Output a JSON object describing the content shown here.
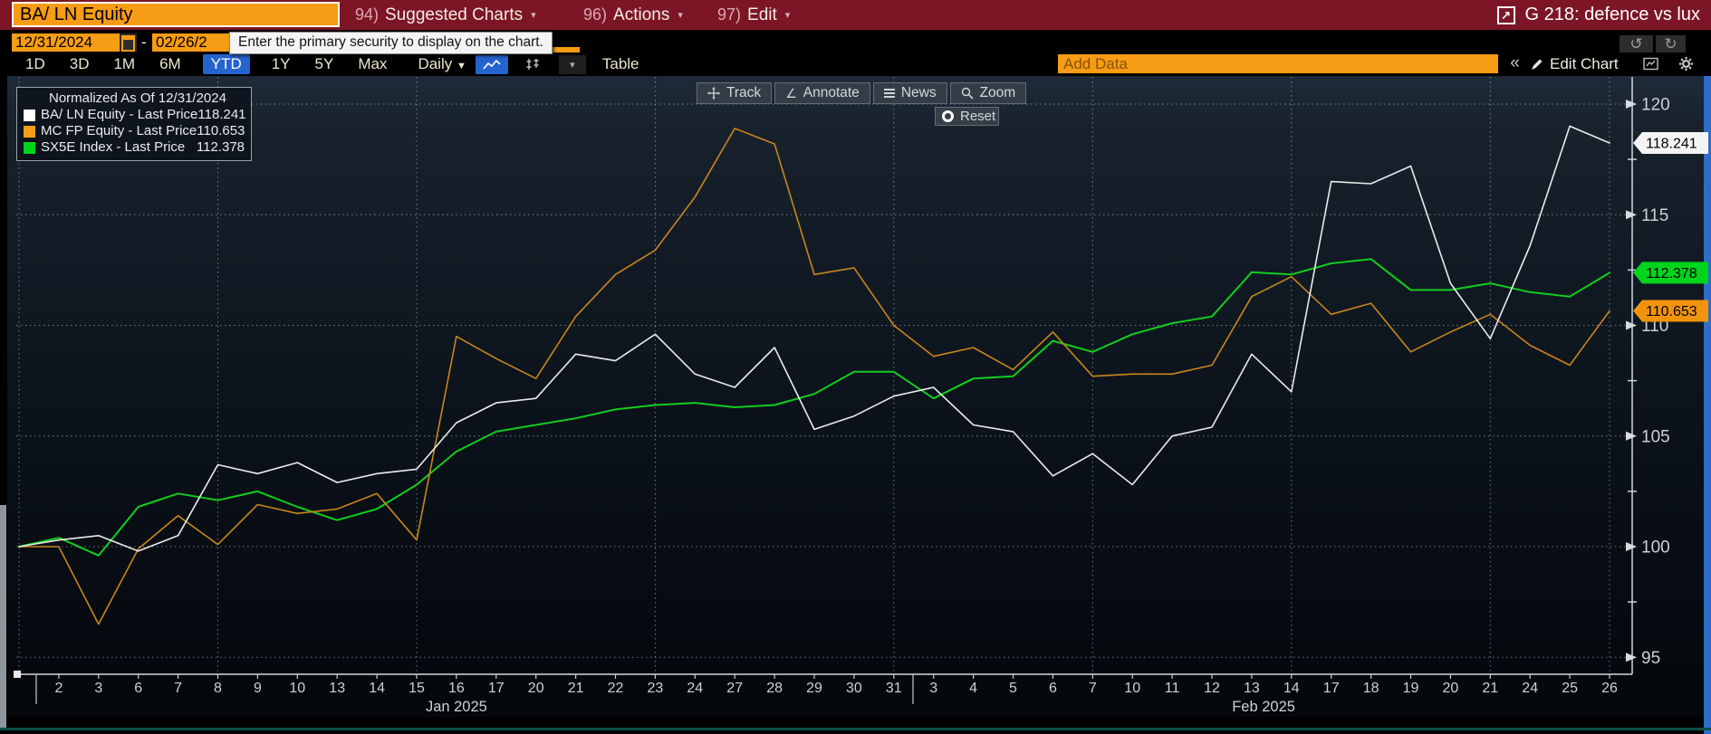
{
  "title_bar": {
    "security_input": "BA/ LN Equity",
    "menus": [
      {
        "num": "94)",
        "label": "Suggested Charts"
      },
      {
        "num": "96)",
        "label": "Actions"
      },
      {
        "num": "97)",
        "label": "Edit"
      }
    ],
    "chart_name": "G 218: defence vs lux",
    "bar_color": "#7c1627",
    "field_color": "#f79c15"
  },
  "tooltip": "Enter the primary security to display on the chart.",
  "date_row": {
    "start_date": "12/31/2024",
    "separator": "-",
    "end_date": "02/26/2"
  },
  "toolbar": {
    "periods": [
      "1D",
      "3D",
      "1M",
      "6M",
      "YTD",
      "1Y",
      "5Y",
      "Max"
    ],
    "selected_period": "YTD",
    "frequency": "Daily",
    "table_label": "Table",
    "add_data_placeholder": "Add Data",
    "collapse_label": "«",
    "edit_chart_label": "Edit Chart",
    "undo_icon": "↺",
    "redo_icon": "↻",
    "accent_blue": "#2563cf"
  },
  "chart_tools": {
    "buttons": [
      "Track",
      "Annotate",
      "News",
      "Zoom"
    ],
    "reset_label": "Reset"
  },
  "legend": {
    "title": "Normalized As Of 12/31/2024",
    "items": [
      {
        "label": "BA/ LN Equity - Last Price",
        "value": "118.241",
        "color": "#ffffff"
      },
      {
        "label": "MC FP Equity - Last Price",
        "value": "110.653",
        "color": "#f59f16"
      },
      {
        "label": "SX5E Index - Last Price",
        "value": "112.378",
        "color": "#00d41c"
      }
    ]
  },
  "chart_data": {
    "type": "line",
    "title": "Normalized As Of 12/31/2024",
    "x_dates": [
      "12/31",
      "01/02",
      "01/03",
      "01/06",
      "01/07",
      "01/08",
      "01/09",
      "01/10",
      "01/13",
      "01/14",
      "01/15",
      "01/16",
      "01/17",
      "01/20",
      "01/21",
      "01/22",
      "01/23",
      "01/24",
      "01/27",
      "01/28",
      "01/29",
      "01/30",
      "01/31",
      "02/03",
      "02/04",
      "02/05",
      "02/06",
      "02/07",
      "02/10",
      "02/11",
      "02/12",
      "02/13",
      "02/14",
      "02/17",
      "02/18",
      "02/19",
      "02/20",
      "02/21",
      "02/24",
      "02/25",
      "02/26"
    ],
    "x_tick_labels": [
      "",
      "2",
      "3",
      "6",
      "7",
      "8",
      "9",
      "10",
      "13",
      "14",
      "15",
      "16",
      "17",
      "20",
      "21",
      "22",
      "23",
      "24",
      "27",
      "28",
      "29",
      "30",
      "31",
      "3",
      "4",
      "5",
      "6",
      "7",
      "10",
      "11",
      "12",
      "13",
      "14",
      "17",
      "18",
      "19",
      "20",
      "21",
      "24",
      "25",
      "26"
    ],
    "month_labels": [
      {
        "text": "Jan 2025",
        "x_index": 11.0
      },
      {
        "text": "Feb 2025",
        "x_index": 31.3
      }
    ],
    "series": [
      {
        "name": "SX5E Index - Last Price",
        "last_label": "112.378",
        "line_color": "#12cd1e",
        "tag_color": "#00d41c",
        "width": 2,
        "values": [
          100,
          100.4,
          99.6,
          101.8,
          102.4,
          102.1,
          102.5,
          101.8,
          101.2,
          101.7,
          102.8,
          104.3,
          105.2,
          105.5,
          105.8,
          106.2,
          106.4,
          106.5,
          106.3,
          106.4,
          106.9,
          107.9,
          107.9,
          106.7,
          107.6,
          107.7,
          109.3,
          108.8,
          109.6,
          110.1,
          110.4,
          112.4,
          112.3,
          112.8,
          113.0,
          111.6,
          111.6,
          111.9,
          111.5,
          111.3,
          112.378
        ]
      },
      {
        "name": "MC FP Equity - Last Price",
        "last_label": "110.653",
        "line_color": "#c9851b",
        "tag_color": "#f2930c",
        "width": 1.6,
        "values": [
          100,
          100.0,
          96.5,
          99.9,
          101.4,
          100.1,
          101.9,
          101.5,
          101.7,
          102.4,
          100.3,
          109.5,
          108.5,
          107.6,
          110.4,
          112.3,
          113.4,
          115.8,
          118.9,
          118.2,
          112.3,
          112.6,
          110.0,
          108.6,
          109.0,
          108.0,
          109.7,
          107.7,
          107.8,
          107.8,
          108.2,
          111.3,
          112.2,
          110.5,
          111.0,
          108.8,
          109.7,
          110.5,
          109.1,
          108.2,
          110.653
        ]
      },
      {
        "name": "BA/ LN Equity - Last Price",
        "last_label": "118.241",
        "line_color": "#e9ebeb",
        "tag_color": "#f4f4f4",
        "width": 1.6,
        "values": [
          100,
          100.3,
          100.5,
          99.8,
          100.5,
          103.7,
          103.3,
          103.8,
          102.9,
          103.3,
          103.5,
          105.6,
          106.5,
          106.7,
          108.7,
          108.4,
          109.6,
          107.8,
          107.2,
          109.0,
          105.3,
          105.9,
          106.8,
          107.2,
          105.5,
          105.2,
          103.2,
          104.2,
          102.8,
          105.0,
          105.4,
          108.7,
          107.0,
          116.5,
          116.4,
          117.2,
          111.9,
          109.4,
          113.6,
          119.0,
          118.241
        ]
      }
    ],
    "yticks": [
      95,
      100,
      105,
      110,
      115,
      120
    ],
    "y_minor_ticks": [
      97.5,
      102.5,
      107.5,
      112.5,
      117.5
    ],
    "ylim": [
      94.2,
      121.2
    ],
    "grid_x_indices": [
      0,
      5,
      10,
      16,
      22,
      27,
      32,
      37,
      40
    ],
    "grid": true,
    "legend_position": "top-left",
    "xlabel": "",
    "ylabel": ""
  }
}
